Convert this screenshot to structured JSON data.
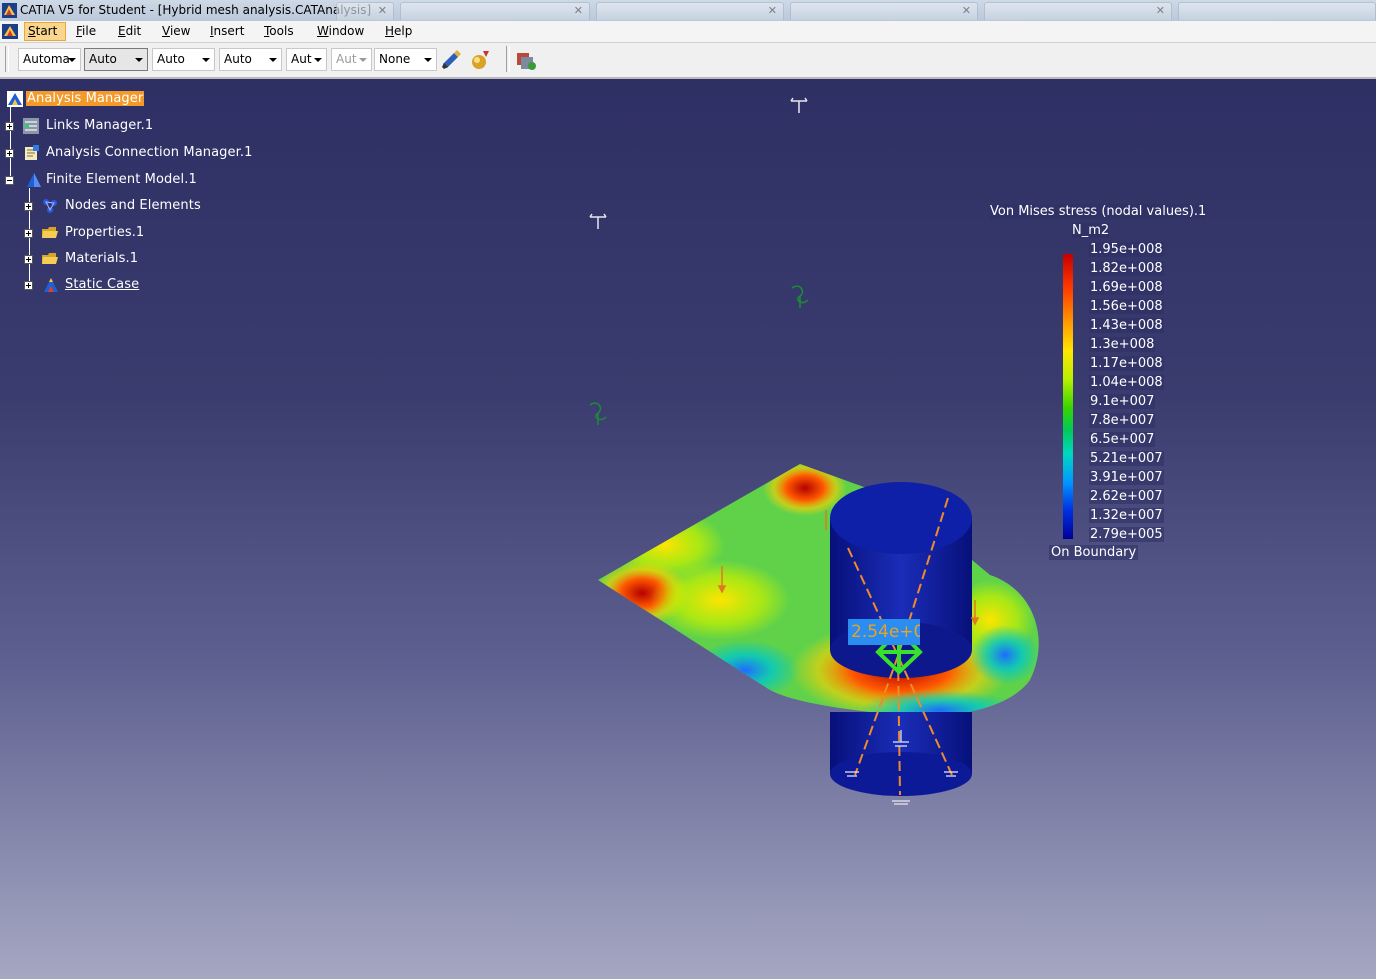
{
  "window": {
    "title": "CATIA V5 for Student - [Hybrid mesh analysis.CATAnalysis]"
  },
  "menubar": {
    "items": [
      {
        "label": "Start",
        "accel": "S"
      },
      {
        "label": "File",
        "accel": "F"
      },
      {
        "label": "Edit",
        "accel": "E"
      },
      {
        "label": "View",
        "accel": "V"
      },
      {
        "label": "Insert",
        "accel": "I"
      },
      {
        "label": "Tools",
        "accel": "T"
      },
      {
        "label": "Window",
        "accel": "W"
      },
      {
        "label": "Help",
        "accel": "H"
      }
    ]
  },
  "toolbar": {
    "combos": [
      {
        "value": "Automa",
        "state": "normal"
      },
      {
        "value": "Auto",
        "state": "selected"
      },
      {
        "value": "Auto",
        "state": "normal"
      },
      {
        "value": "Auto",
        "state": "normal"
      },
      {
        "value": "Aut",
        "state": "normal"
      },
      {
        "value": "Aut",
        "state": "disabled"
      },
      {
        "value": "None",
        "state": "normal"
      }
    ],
    "icons": [
      "paint-brush-icon",
      "material-ball-icon",
      "apply-material-icon"
    ]
  },
  "tree": {
    "root": {
      "label": "Analysis Manager",
      "icon": "analysis-manager-icon"
    },
    "children": [
      {
        "label": "Links Manager.1",
        "icon": "links-manager-icon",
        "expander": "plus"
      },
      {
        "label": "Analysis Connection Manager.1",
        "icon": "connection-manager-icon",
        "expander": "plus"
      },
      {
        "label": "Finite Element Model.1",
        "icon": "fem-icon",
        "expander": "minus"
      }
    ],
    "fem_children": [
      {
        "label": "Nodes and Elements",
        "icon": "nodes-elements-icon"
      },
      {
        "label": "Properties.1",
        "icon": "folder-icon"
      },
      {
        "label": "Materials.1",
        "icon": "folder-icon"
      },
      {
        "label": "Static Case",
        "icon": "static-case-icon",
        "underlined": true
      }
    ]
  },
  "legend": {
    "title": "Von Mises stress (nodal values).1",
    "unit": "N_m2",
    "ticks": [
      "1.95e+008",
      "1.82e+008",
      "1.69e+008",
      "1.56e+008",
      "1.43e+008",
      "1.3e+008",
      "1.17e+008",
      "1.04e+008",
      "9.1e+007",
      "7.8e+007",
      "6.5e+007",
      "5.21e+007",
      "3.91e+007",
      "2.62e+007",
      "1.32e+007",
      "2.79e+005"
    ],
    "footer": "On Boundary",
    "colors": {
      "max": "#c40000",
      "mid": "#37d400",
      "min": "#000098"
    }
  },
  "probe": {
    "value": "2.54e+0"
  },
  "colors": {
    "selection": "#f39a2a",
    "viewport_top": "#2e2f64",
    "viewport_bottom": "#a5a8c2",
    "probe_bg": "#2a8df0"
  }
}
